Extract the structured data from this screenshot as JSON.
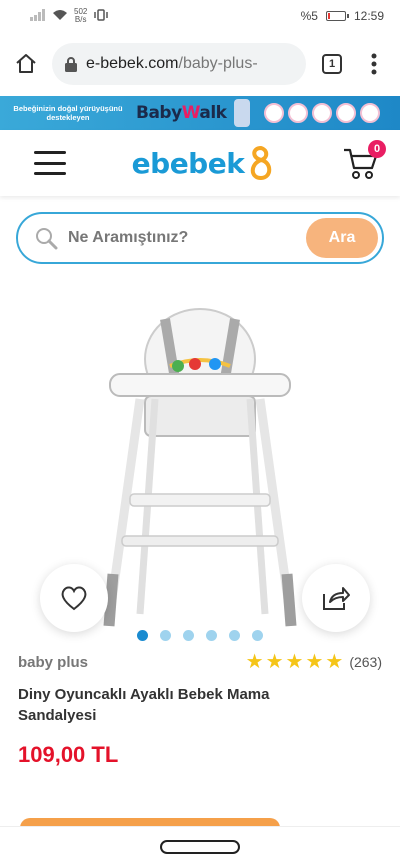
{
  "status": {
    "netspeed_value": "502",
    "netspeed_unit": "B/s",
    "battery": "%5",
    "time": "12:59"
  },
  "browser": {
    "url_domain": "e-bebek.com",
    "url_path": "/baby-plus-",
    "tab_count": "1"
  },
  "banner": {
    "text": "Bebeğinizin doğal yürüyüşünü destekleyen",
    "logo_part1": "Baby",
    "logo_part2": "W",
    "logo_part3": "alk"
  },
  "header": {
    "logo": "ebebek",
    "cart_count": "0"
  },
  "search": {
    "placeholder": "Ne Aramıştınız?",
    "button": "Ara"
  },
  "gallery": {
    "slide_count": 6,
    "active_index": 0
  },
  "product": {
    "brand": "baby plus",
    "rating": 5,
    "review_count": "(263)",
    "title": "Diny Oyuncaklı Ayaklı Bebek Mama Sandalyesi",
    "price": "109,00 TL"
  },
  "colors": {
    "accent_blue": "#1a9ad6",
    "search_button": "#f7b47d",
    "price_red": "#e4122a",
    "star": "#f5c518"
  }
}
